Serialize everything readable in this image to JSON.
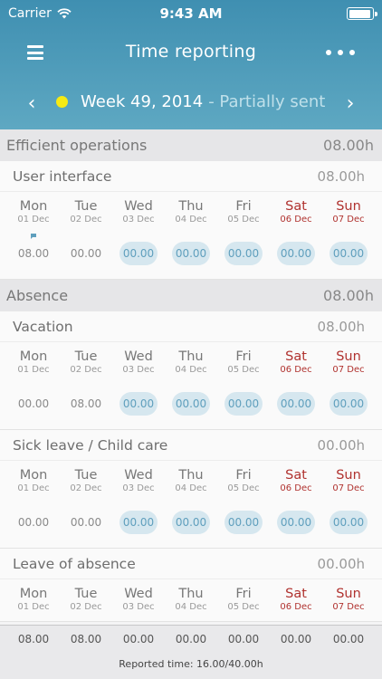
{
  "status_bar": {
    "carrier": "Carrier",
    "time": "9:43 AM"
  },
  "nav": {
    "title": "Time reporting",
    "menu_icon": "hamburger-icon",
    "more_icon": "more-dots-icon"
  },
  "week": {
    "label": "Week 49, 2014",
    "status": "- Partially sent",
    "status_color": "#f6ea14"
  },
  "days": [
    {
      "name": "Mon",
      "date": "01 Dec",
      "weekend": false
    },
    {
      "name": "Tue",
      "date": "02 Dec",
      "weekend": false
    },
    {
      "name": "Wed",
      "date": "03 Dec",
      "weekend": false
    },
    {
      "name": "Thu",
      "date": "04 Dec",
      "weekend": false
    },
    {
      "name": "Fri",
      "date": "05 Dec",
      "weekend": false
    },
    {
      "name": "Sat",
      "date": "06 Dec",
      "weekend": true
    },
    {
      "name": "Sun",
      "date": "07 Dec",
      "weekend": true
    }
  ],
  "sections": [
    {
      "title": "Efficient operations",
      "total": "08.00h",
      "activities": [
        {
          "name": "User interface",
          "hours": "08.00h",
          "comment_day": 0,
          "values": [
            {
              "v": "08.00",
              "editable": false
            },
            {
              "v": "00.00",
              "editable": false
            },
            {
              "v": "00.00",
              "editable": true
            },
            {
              "v": "00.00",
              "editable": true
            },
            {
              "v": "00.00",
              "editable": true
            },
            {
              "v": "00.00",
              "editable": true
            },
            {
              "v": "00.00",
              "editable": true
            }
          ]
        }
      ]
    },
    {
      "title": "Absence",
      "total": "08.00h",
      "activities": [
        {
          "name": "Vacation",
          "hours": "08.00h",
          "comment_day": -1,
          "values": [
            {
              "v": "00.00",
              "editable": false
            },
            {
              "v": "08.00",
              "editable": false
            },
            {
              "v": "00.00",
              "editable": true
            },
            {
              "v": "00.00",
              "editable": true
            },
            {
              "v": "00.00",
              "editable": true
            },
            {
              "v": "00.00",
              "editable": true
            },
            {
              "v": "00.00",
              "editable": true
            }
          ]
        },
        {
          "name": "Sick leave / Child care",
          "hours": "00.00h",
          "comment_day": -1,
          "values": [
            {
              "v": "00.00",
              "editable": false
            },
            {
              "v": "00.00",
              "editable": false
            },
            {
              "v": "00.00",
              "editable": true
            },
            {
              "v": "00.00",
              "editable": true
            },
            {
              "v": "00.00",
              "editable": true
            },
            {
              "v": "00.00",
              "editable": true
            },
            {
              "v": "00.00",
              "editable": true
            }
          ]
        },
        {
          "name": "Leave of absence",
          "hours": "00.00h",
          "comment_day": -1,
          "values": []
        }
      ]
    }
  ],
  "footer": {
    "totals": [
      "08.00",
      "08.00",
      "00.00",
      "00.00",
      "00.00",
      "00.00",
      "00.00"
    ],
    "reported": "Reported time: 16.00/40.00h"
  }
}
